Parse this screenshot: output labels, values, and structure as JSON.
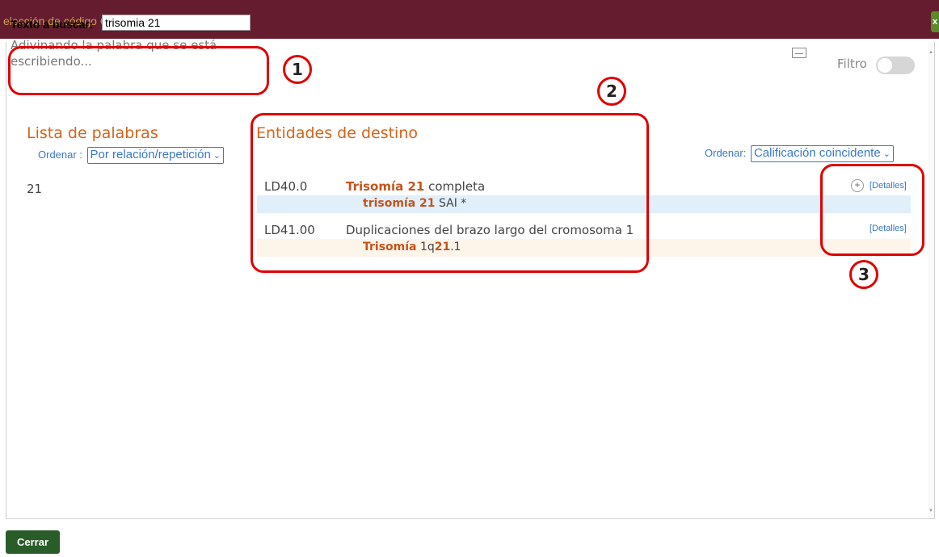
{
  "window": {
    "title": "elección de código CIE 11",
    "close_glyph": "x"
  },
  "search": {
    "label": "Texto a buscar:",
    "value": "trisomia 21",
    "hint": "Adivinando la palabra que se está escribiendo..."
  },
  "filter": {
    "label": "Filtro",
    "enabled": false
  },
  "word_list": {
    "heading": "Lista de palabras",
    "order_label": "Ordenar :",
    "order_value": "Por relación/repetición",
    "words": [
      "21"
    ]
  },
  "entities": {
    "heading": "Entidades de destino",
    "order_label": "Ordenar:",
    "order_value": "Calificación coincidente",
    "items": [
      {
        "code": "LD40.0",
        "title_hl": "Trisomía 21",
        "title_rest": " completa",
        "sub_hl": "trisomía 21",
        "sub_rest": " SAI  *",
        "details": "[Detalles]"
      },
      {
        "code": "LD41.00",
        "title": "Duplicaciones del brazo largo del cromosoma 1",
        "sub_hl1": "Trisomía",
        "sub_mid": " 1q",
        "sub_hl2": "21",
        "sub_end": ".1",
        "details": "[Detalles]"
      }
    ]
  },
  "annotations": [
    "1",
    "2",
    "3"
  ],
  "footer": {
    "close_label": "Cerrar"
  },
  "colors": {
    "titlebar": "#651c2e",
    "accent": "#d4641c",
    "link": "#3a78c8",
    "annotation": "#e00000",
    "close_button": "#2a5c2a"
  }
}
